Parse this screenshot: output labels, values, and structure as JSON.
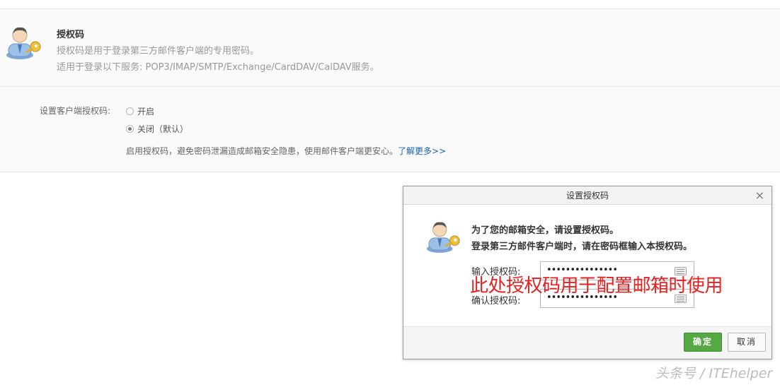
{
  "info": {
    "title": "授权码",
    "line1": "授权码是用于登录第三方邮件客户端的专用密码。",
    "line2": "适用于登录以下服务: POP3/IMAP/SMTP/Exchange/CardDAV/CalDAV服务。"
  },
  "settings": {
    "label": "设置客户端授权码:",
    "options": [
      {
        "label": "开启",
        "checked": false
      },
      {
        "label": "关闭（默认）",
        "checked": true
      }
    ],
    "hint": "启用授权码，避免密码泄漏造成邮箱安全隐患，使用邮件客户端更安心。",
    "learn_more": "了解更多>>"
  },
  "dialog": {
    "title": "设置授权码",
    "close": "×",
    "message1": "为了您的邮箱安全，请设置授权码。",
    "message2": "登录第三方邮件客户端时，请在密码框输入本授权码。",
    "input_label": "输入授权码:",
    "confirm_label": "确认授权码:",
    "input_value": "•••••••••••••••",
    "confirm_value": "•••••••••••••••",
    "annotation": "此处授权码用于配置邮箱时使用",
    "ok_label": "确定",
    "cancel_label": "取消"
  },
  "watermark": "头条号 / ITEhelper",
  "colors": {
    "ok_button": "#56a843",
    "link": "#1a62b4",
    "annotation": "#e82020"
  },
  "icons": [
    "user-key-icon",
    "close-icon",
    "keyboard-icon"
  ]
}
